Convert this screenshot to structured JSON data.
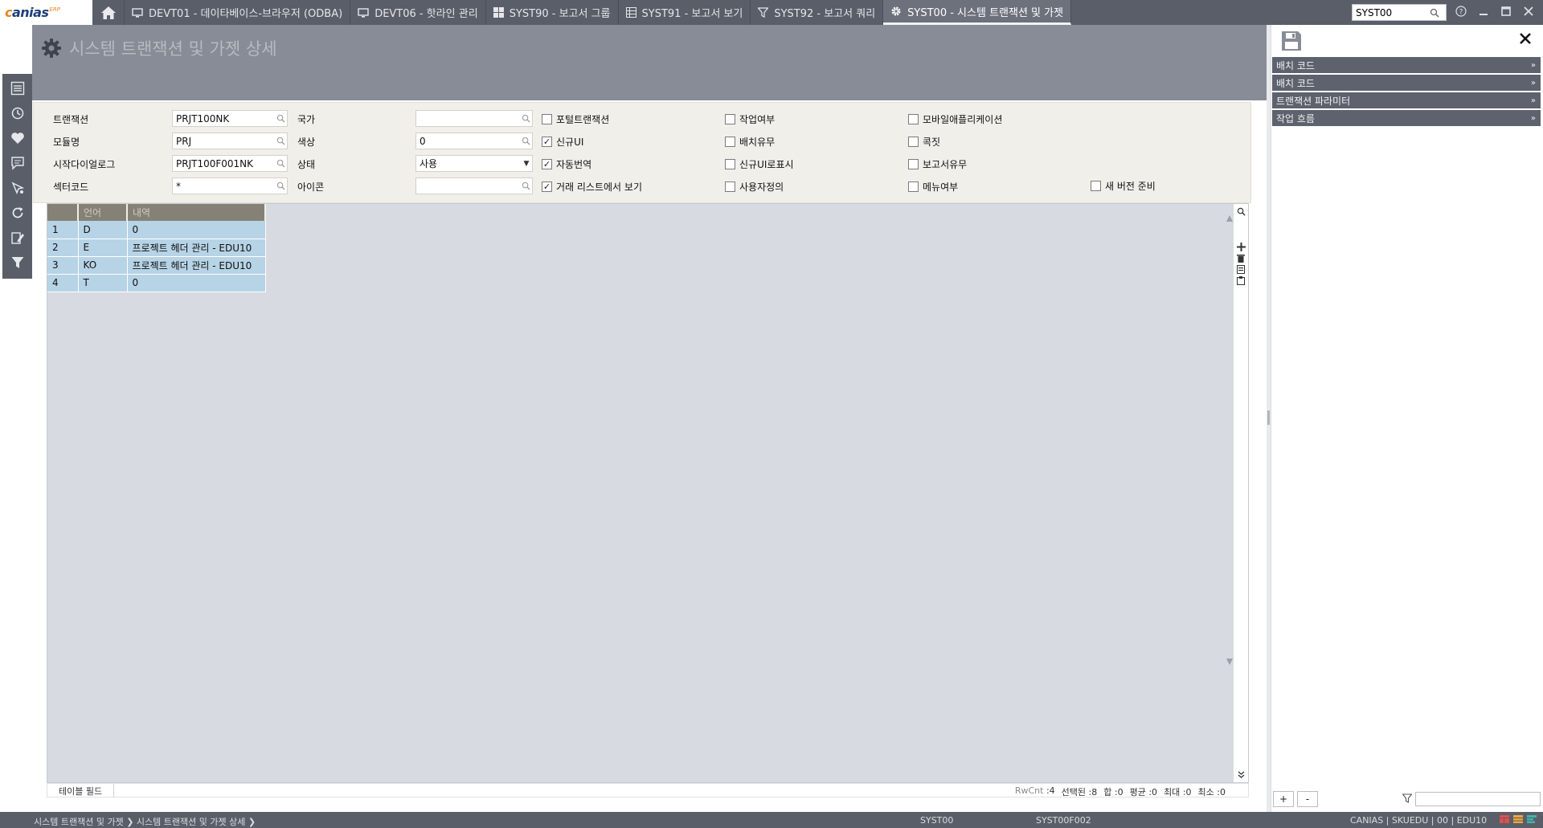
{
  "app": {
    "logo_text": "canias",
    "logo_sub": "ERP"
  },
  "tabs": [
    {
      "label": "DEVT01 - 데이타베이스-브라우저 (ODBA)",
      "icon": "monitor-icon",
      "active": false
    },
    {
      "label": "DEVT06 - 핫라인 관리",
      "icon": "monitor-icon",
      "active": false
    },
    {
      "label": "SYST90 - 보고서 그룹",
      "icon": "grid-icon",
      "active": false
    },
    {
      "label": "SYST91 - 보고서 보기",
      "icon": "grid-icon",
      "active": false
    },
    {
      "label": "SYST92 - 보고서 쿼리",
      "icon": "filter-icon",
      "active": false
    },
    {
      "label": "SYST00 - 시스템 트랜잭션 및 가젯",
      "icon": "gear-icon",
      "active": true
    }
  ],
  "top_search": {
    "value": "SYST00"
  },
  "page": {
    "title": "시스템 트랜잭션 및 가젯 상세"
  },
  "form": {
    "transaction_label": "트랜잭션",
    "transaction_value": "PRJT100NK",
    "module_label": "모듈명",
    "module_value": "PRJ",
    "start_dialog_label": "시작다이얼로그",
    "start_dialog_value": "PRJT100F001NK",
    "sector_label": "섹터코드",
    "sector_value": "*",
    "country_label": "국가",
    "country_value": "",
    "color_label": "색상",
    "color_value": "0",
    "status_label": "상태",
    "status_value": "사용",
    "icon_label": "아이콘",
    "icon_value": "",
    "checkboxes": {
      "portal_transaction": {
        "label": "포털트랜잭션",
        "checked": false
      },
      "new_ui": {
        "label": "신규UI",
        "checked": true
      },
      "auto_translate": {
        "label": "자동번역",
        "checked": true
      },
      "show_in_list": {
        "label": "거래 리스트에서 보기",
        "checked": true
      },
      "work_flag": {
        "label": "작업여부",
        "checked": false
      },
      "batch_flag": {
        "label": "배치유무",
        "checked": false
      },
      "new_ui_logo": {
        "label": "신규UI로표시",
        "checked": false
      },
      "user_defined": {
        "label": "사용자정의",
        "checked": false
      },
      "mobile_app": {
        "label": "모바일애플리케이션",
        "checked": false
      },
      "kokjit": {
        "label": "콕짓",
        "checked": false
      },
      "report_flag": {
        "label": "보고서유무",
        "checked": false
      },
      "menu_flag": {
        "label": "메뉴여부",
        "checked": false
      },
      "new_version": {
        "label": "새 버전 준비",
        "checked": false
      }
    }
  },
  "grid": {
    "columns": [
      "",
      "언어",
      "내역"
    ],
    "rows": [
      {
        "num": "1",
        "lang": "D",
        "desc": "0"
      },
      {
        "num": "2",
        "lang": "E",
        "desc": "프로젝트 헤더 관리 - EDU10"
      },
      {
        "num": "3",
        "lang": "KO",
        "desc": "프로젝트 헤더 관리 - EDU10"
      },
      {
        "num": "4",
        "lang": "T",
        "desc": "0"
      }
    ],
    "footer_tab": "테이블 필드",
    "stats": {
      "rwcnt_label": "RwCnt",
      "rwcnt": ":4",
      "selected_label": "선택된",
      "selected": ":8",
      "sum_label": "합",
      "sum": ":0",
      "avg_label": "평균",
      "avg": ":0",
      "max_label": "최대",
      "max": ":0",
      "min_label": "최소",
      "min": ":0"
    }
  },
  "right_panel": {
    "sections": [
      "배치 코드",
      "배치 코드",
      "트랜잭션 파라미터",
      "작업 흐름"
    ],
    "add_label": "+",
    "remove_label": "-"
  },
  "statusbar": {
    "breadcrumb_1": "시스템 트랜잭션 및 가젯",
    "breadcrumb_2": "시스템 트랜잭션 및 가젯 상세",
    "transaction": "SYST00",
    "dialog": "SYST00F002",
    "session": "CANIAS | SKUEDU | 00 | EDU10"
  },
  "colors": {
    "topbar": "#595e69",
    "header": "#878c96",
    "form_bg": "#f1efea",
    "grid_bg": "#d7dae1",
    "row_bg": "#b7d3e6",
    "grid_header": "#858176"
  }
}
